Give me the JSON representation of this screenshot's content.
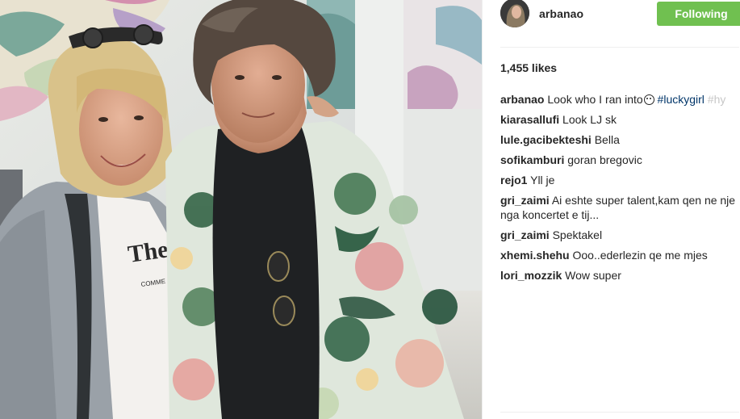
{
  "post": {
    "photo_alt": "Two people posing together",
    "shirt_print": "The Beatles",
    "shirt_sub": "COMME des GARÇONS"
  },
  "header": {
    "username": "arbanao",
    "follow_label": "Following",
    "follow_color": "#70c050"
  },
  "likes_text": "1,455 likes",
  "caption": {
    "user": "arbanao",
    "text": "Look who I ran into",
    "emoji": "smiley-icon",
    "hashtag": "#luckygirl",
    "overflow": " #hy"
  },
  "comments": [
    {
      "user": "kiarasallufi",
      "text": "Look LJ sk"
    },
    {
      "user": "lule.gacibekteshi",
      "text": "Bella"
    },
    {
      "user": "sofikamburi",
      "text": "goran bregovic"
    },
    {
      "user": "rejo1",
      "text": "Yll je"
    },
    {
      "user": "gri_zaimi",
      "text": "Ai eshte super talent,kam qen ne nje nga koncertet e tij..."
    },
    {
      "user": "gri_zaimi",
      "text": "Spektakel"
    },
    {
      "user": "xhemi.shehu",
      "text": "Ooo..ederlezin qe me mjes"
    },
    {
      "user": "lori_mozzik",
      "text": "Wow super"
    }
  ]
}
